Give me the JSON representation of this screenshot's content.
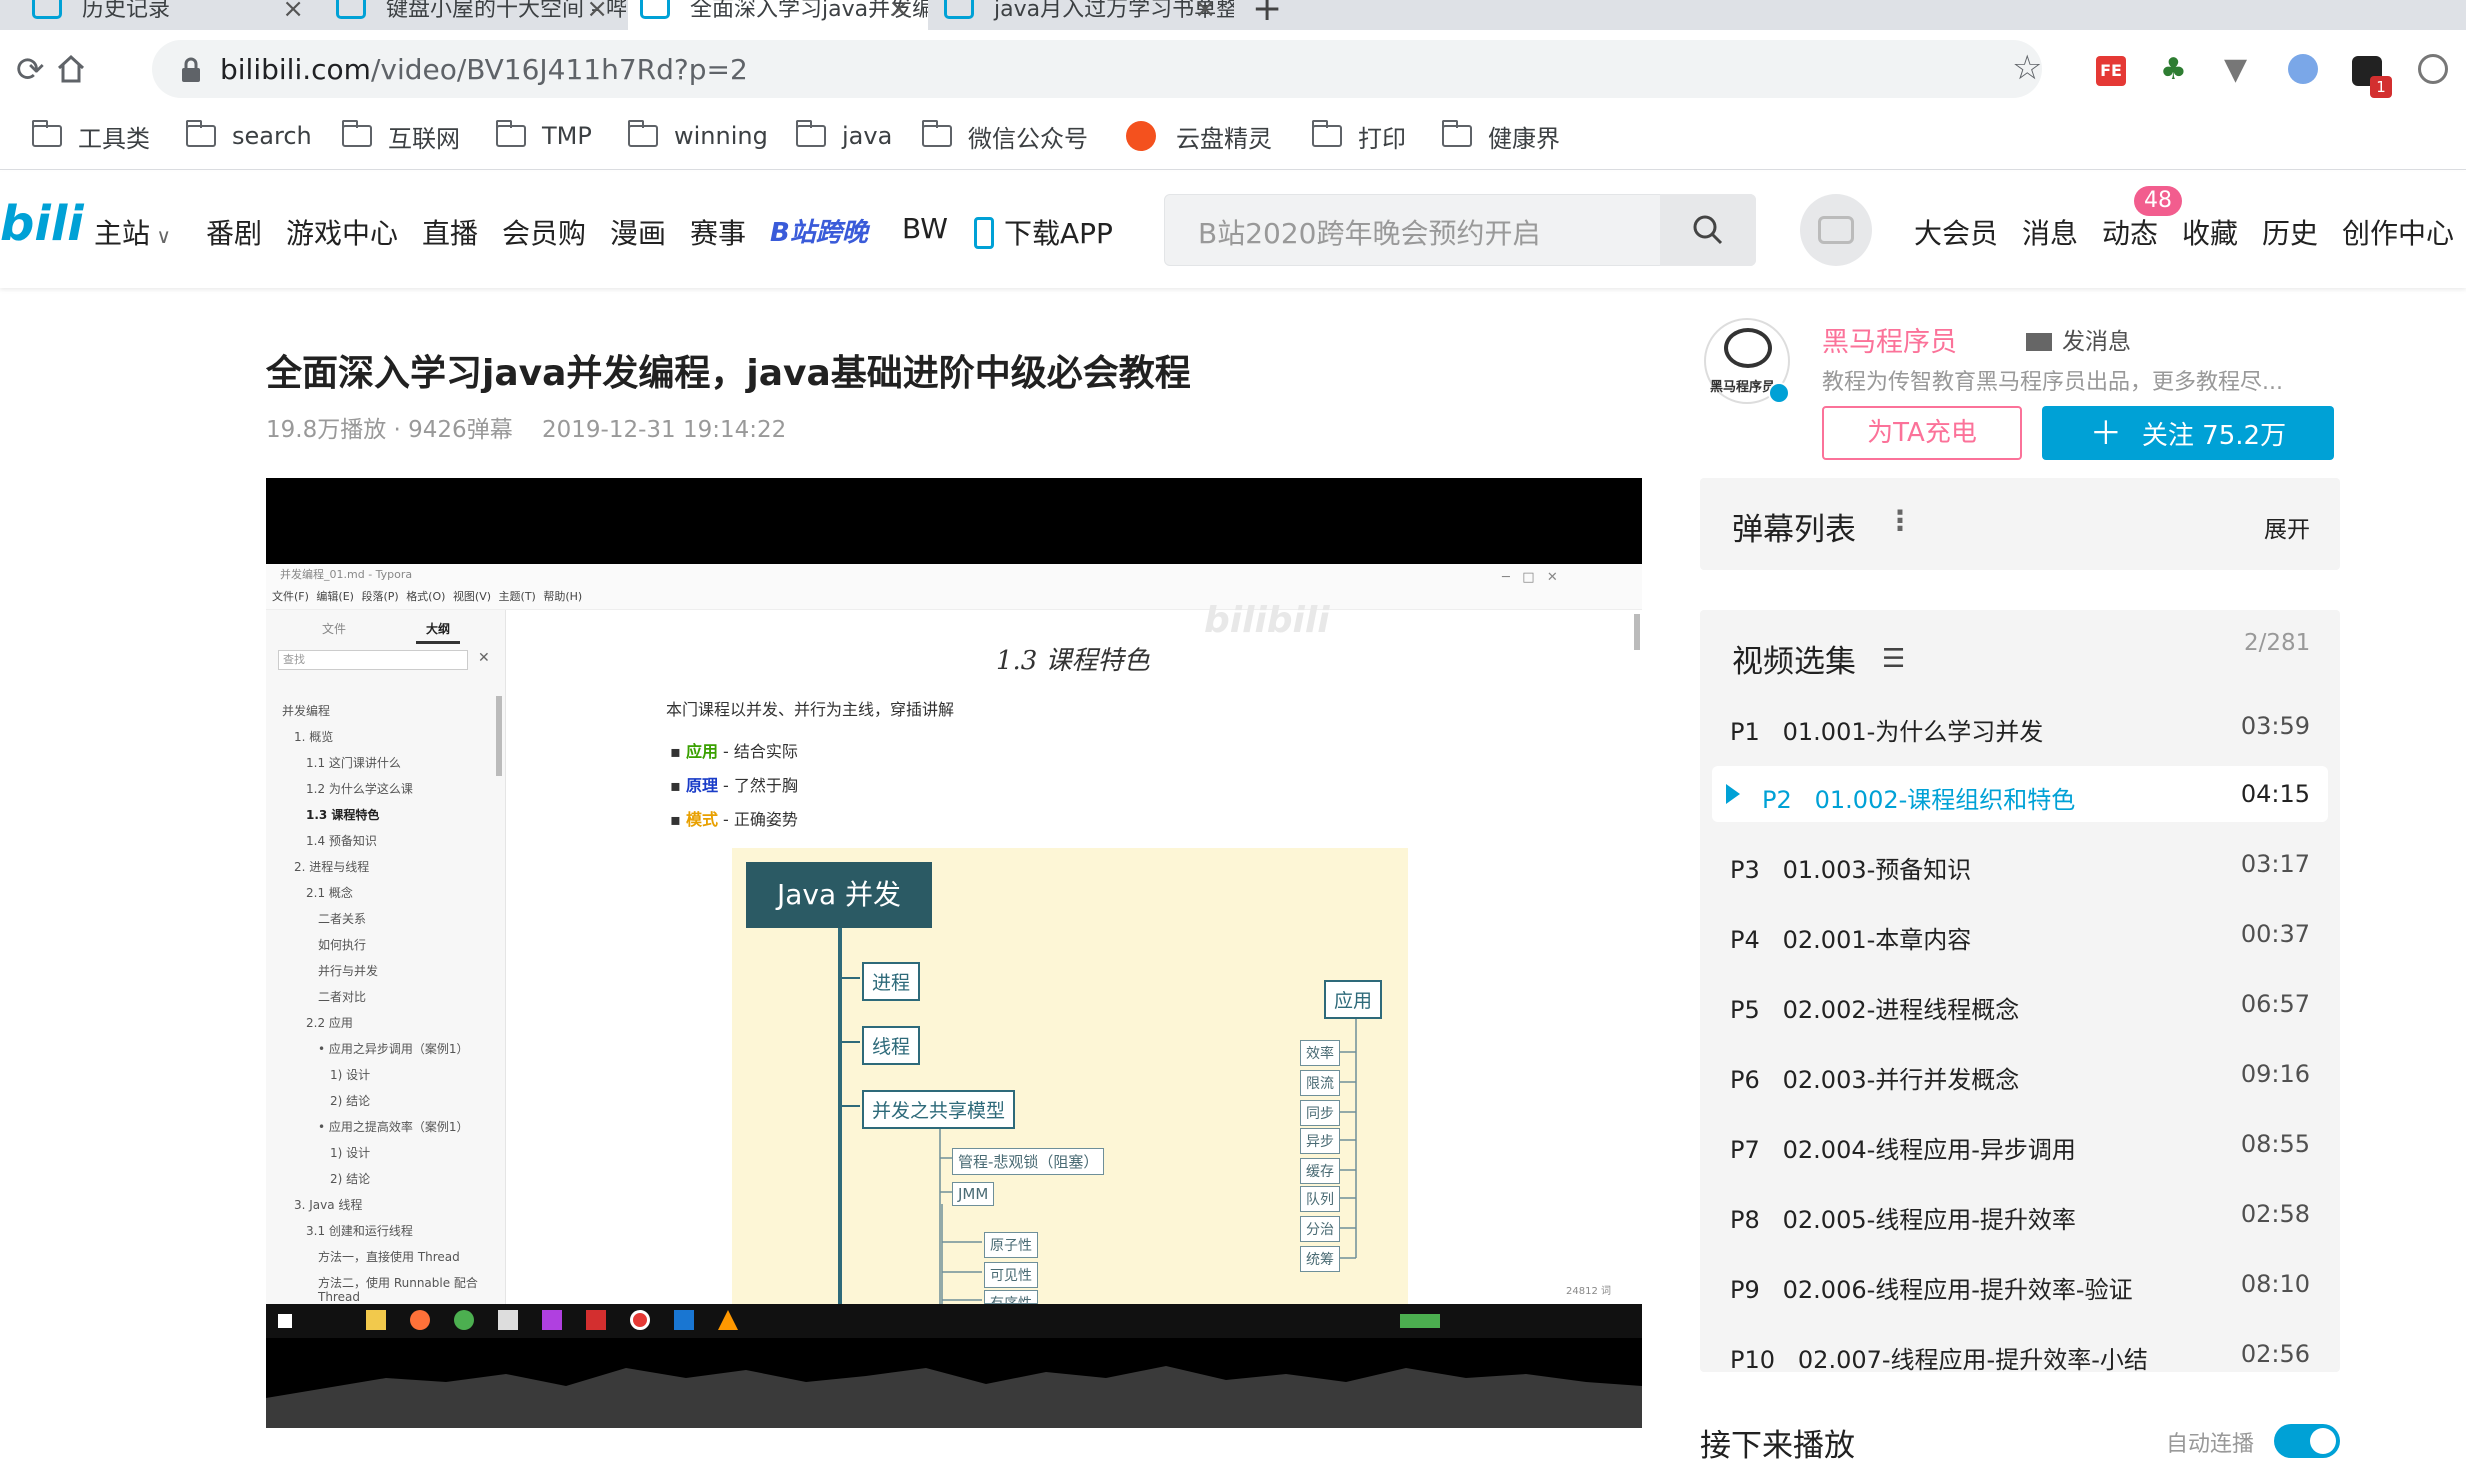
{
  "browser": {
    "tabs": [
      {
        "title": "历史记录",
        "active": false
      },
      {
        "title": "键盘小屋的十大空间 - 哔哩哔哩",
        "active": false
      },
      {
        "title": "全面深入学习java并发编程，java",
        "active": true
      },
      {
        "title": "java月入过万学习书单整理 - 哔哩",
        "active": false
      }
    ],
    "new_tab": "+",
    "url_host": "bilibili.com",
    "url_path": "/video/BV16J411h7Rd?p=2",
    "extension_badge": "1",
    "bookmarks": [
      "工具类",
      "search",
      "互联网",
      "TMP",
      "winning",
      "java",
      "微信公众号",
      "云盘精灵",
      "打印",
      "健康界"
    ]
  },
  "header": {
    "logo": "bili",
    "nav": [
      "主站",
      "番剧",
      "游戏中心",
      "直播",
      "会员购",
      "漫画",
      "赛事",
      "B站跨晚",
      "BW",
      "下载APP"
    ],
    "search_placeholder": "B站2020跨年晚会预约开启",
    "right_nav": [
      "大会员",
      "消息",
      "动态",
      "收藏",
      "历史",
      "创作中心"
    ],
    "dynamic_badge": "48"
  },
  "video": {
    "title": "全面深入学习java并发编程，java基础进阶中级必会教程",
    "plays": "19.8万播放",
    "danmaku": "9426弹幕",
    "date": "2019-12-31 19:14:22",
    "meta_sep": " · "
  },
  "typora": {
    "window_title": "并发编程_01.md - Typora",
    "menu": [
      "文件(F)",
      "编辑(E)",
      "段落(P)",
      "格式(O)",
      "视图(V)",
      "主题(T)",
      "帮助(H)"
    ],
    "sidebar_tabs": [
      "文件",
      "大纲"
    ],
    "search_placeholder": "查找",
    "outline": [
      "并发编程",
      "1. 概览",
      "1.1 这门课讲什么",
      "1.2 为什么学这么课",
      "1.3 课程特色",
      "1.4 预备知识",
      "2. 进程与线程",
      "2.1 概念",
      "二者关系",
      "如何执行",
      "并行与并发",
      "二者对比",
      "2.2 应用",
      "• 应用之异步调用（案例1）",
      "1) 设计",
      "2) 结论",
      "• 应用之提高效率（案例1）",
      "1) 设计",
      "2) 结论",
      "3. Java 线程",
      "3.1 创建和运行线程",
      "方法一，直接使用 Thread",
      "方法二，使用 Runnable 配合",
      "Thread"
    ],
    "heading": "1.3 课程特色",
    "intro": "本门课程以并发、并行为主线，穿插讲解",
    "bullets": [
      {
        "key": "应用",
        "rest": " - 结合实际",
        "color": "#3aa000"
      },
      {
        "key": "原理",
        "rest": " - 了然于胸",
        "color": "#1a3cc8"
      },
      {
        "key": "模式",
        "rest": " - 正确姿势",
        "color": "#e8a000"
      }
    ],
    "word_count": "24812 词",
    "watermark": "bilibili"
  },
  "mindmap": {
    "title": "Java 并发",
    "left_nodes": [
      "进程",
      "线程",
      "并发之共享模型"
    ],
    "shared_children": [
      "管程-悲观锁（阻塞）",
      "JMM"
    ],
    "jmm_children": [
      "原子性",
      "可见性",
      "有序性"
    ],
    "right_node": "应用",
    "right_children": [
      "效率",
      "限流",
      "同步",
      "异步",
      "缓存",
      "队列",
      "分治",
      "统筹"
    ]
  },
  "up": {
    "name": "黑马程序员",
    "message": "发消息",
    "desc": "教程为传智教育黑马程序员出品，更多教程尽...",
    "charge": "为TA充电",
    "follow": "关注 75.2万",
    "logo_text": "黑马程序员"
  },
  "danmaku_panel": {
    "title": "弹幕列表",
    "expand": "展开"
  },
  "playlist": {
    "title": "视频选集",
    "count": "2/281",
    "items": [
      {
        "p": "P1",
        "title": "01.001-为什么学习并发",
        "dur": "03:59"
      },
      {
        "p": "P2",
        "title": "01.002-课程组织和特色",
        "dur": "04:15"
      },
      {
        "p": "P3",
        "title": "01.003-预备知识",
        "dur": "03:17"
      },
      {
        "p": "P4",
        "title": "02.001-本章内容",
        "dur": "00:37"
      },
      {
        "p": "P5",
        "title": "02.002-进程线程概念",
        "dur": "06:57"
      },
      {
        "p": "P6",
        "title": "02.003-并行并发概念",
        "dur": "09:16"
      },
      {
        "p": "P7",
        "title": "02.004-线程应用-异步调用",
        "dur": "08:55"
      },
      {
        "p": "P8",
        "title": "02.005-线程应用-提升效率",
        "dur": "02:58"
      },
      {
        "p": "P9",
        "title": "02.006-线程应用-提升效率-验证",
        "dur": "08:10"
      },
      {
        "p": "P10",
        "title": "02.007-线程应用-提升效率-小结",
        "dur": "02:56"
      }
    ]
  },
  "next": {
    "title": "接下来播放",
    "autoplay": "自动连播",
    "autoplay_on": true
  },
  "colors": {
    "accent": "#00a1d6",
    "pink": "#fb7299",
    "badge": "#f25d8e"
  }
}
